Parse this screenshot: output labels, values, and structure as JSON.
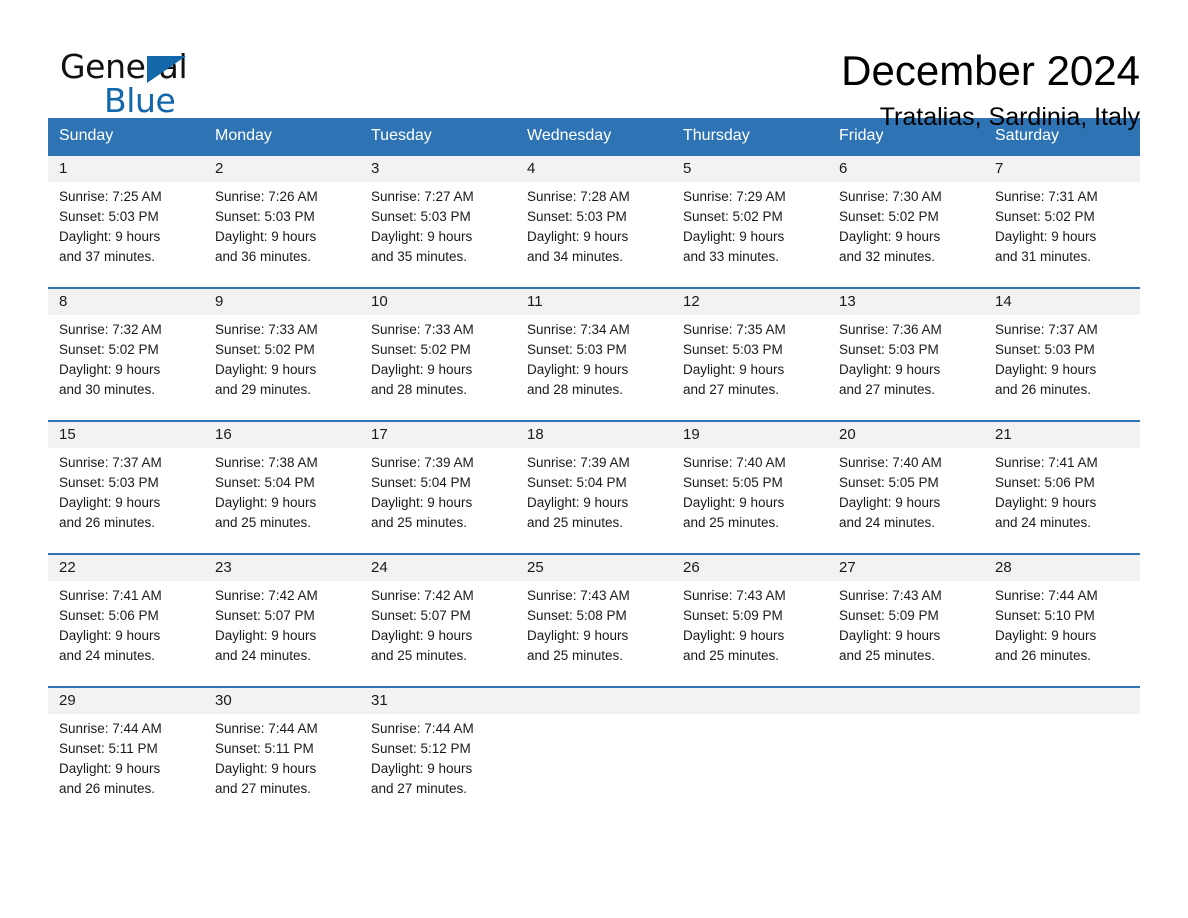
{
  "brand": {
    "name_dark": "General",
    "name_light": "Blue",
    "triangle_color": "#1368ab"
  },
  "header": {
    "title": "December 2024",
    "subtitle": "Tratalias, Sardinia, Italy"
  },
  "theme": {
    "header_blue": "#2e74b5",
    "daynum_band": "#f2f2f2",
    "text": "#1a1a1a"
  },
  "weekday_headers": [
    "Sunday",
    "Monday",
    "Tuesday",
    "Wednesday",
    "Thursday",
    "Friday",
    "Saturday"
  ],
  "labels": {
    "sunrise_prefix": "Sunrise:",
    "sunset_prefix": "Sunset:",
    "daylight_prefix": "Daylight:"
  },
  "weeks": [
    [
      {
        "day": "1",
        "sunrise": "Sunrise: 7:25 AM",
        "sunset": "Sunset: 5:03 PM",
        "daylight_line1": "Daylight: 9 hours",
        "daylight_line2": "and 37 minutes."
      },
      {
        "day": "2",
        "sunrise": "Sunrise: 7:26 AM",
        "sunset": "Sunset: 5:03 PM",
        "daylight_line1": "Daylight: 9 hours",
        "daylight_line2": "and 36 minutes."
      },
      {
        "day": "3",
        "sunrise": "Sunrise: 7:27 AM",
        "sunset": "Sunset: 5:03 PM",
        "daylight_line1": "Daylight: 9 hours",
        "daylight_line2": "and 35 minutes."
      },
      {
        "day": "4",
        "sunrise": "Sunrise: 7:28 AM",
        "sunset": "Sunset: 5:03 PM",
        "daylight_line1": "Daylight: 9 hours",
        "daylight_line2": "and 34 minutes."
      },
      {
        "day": "5",
        "sunrise": "Sunrise: 7:29 AM",
        "sunset": "Sunset: 5:02 PM",
        "daylight_line1": "Daylight: 9 hours",
        "daylight_line2": "and 33 minutes."
      },
      {
        "day": "6",
        "sunrise": "Sunrise: 7:30 AM",
        "sunset": "Sunset: 5:02 PM",
        "daylight_line1": "Daylight: 9 hours",
        "daylight_line2": "and 32 minutes."
      },
      {
        "day": "7",
        "sunrise": "Sunrise: 7:31 AM",
        "sunset": "Sunset: 5:02 PM",
        "daylight_line1": "Daylight: 9 hours",
        "daylight_line2": "and 31 minutes."
      }
    ],
    [
      {
        "day": "8",
        "sunrise": "Sunrise: 7:32 AM",
        "sunset": "Sunset: 5:02 PM",
        "daylight_line1": "Daylight: 9 hours",
        "daylight_line2": "and 30 minutes."
      },
      {
        "day": "9",
        "sunrise": "Sunrise: 7:33 AM",
        "sunset": "Sunset: 5:02 PM",
        "daylight_line1": "Daylight: 9 hours",
        "daylight_line2": "and 29 minutes."
      },
      {
        "day": "10",
        "sunrise": "Sunrise: 7:33 AM",
        "sunset": "Sunset: 5:02 PM",
        "daylight_line1": "Daylight: 9 hours",
        "daylight_line2": "and 28 minutes."
      },
      {
        "day": "11",
        "sunrise": "Sunrise: 7:34 AM",
        "sunset": "Sunset: 5:03 PM",
        "daylight_line1": "Daylight: 9 hours",
        "daylight_line2": "and 28 minutes."
      },
      {
        "day": "12",
        "sunrise": "Sunrise: 7:35 AM",
        "sunset": "Sunset: 5:03 PM",
        "daylight_line1": "Daylight: 9 hours",
        "daylight_line2": "and 27 minutes."
      },
      {
        "day": "13",
        "sunrise": "Sunrise: 7:36 AM",
        "sunset": "Sunset: 5:03 PM",
        "daylight_line1": "Daylight: 9 hours",
        "daylight_line2": "and 27 minutes."
      },
      {
        "day": "14",
        "sunrise": "Sunrise: 7:37 AM",
        "sunset": "Sunset: 5:03 PM",
        "daylight_line1": "Daylight: 9 hours",
        "daylight_line2": "and 26 minutes."
      }
    ],
    [
      {
        "day": "15",
        "sunrise": "Sunrise: 7:37 AM",
        "sunset": "Sunset: 5:03 PM",
        "daylight_line1": "Daylight: 9 hours",
        "daylight_line2": "and 26 minutes."
      },
      {
        "day": "16",
        "sunrise": "Sunrise: 7:38 AM",
        "sunset": "Sunset: 5:04 PM",
        "daylight_line1": "Daylight: 9 hours",
        "daylight_line2": "and 25 minutes."
      },
      {
        "day": "17",
        "sunrise": "Sunrise: 7:39 AM",
        "sunset": "Sunset: 5:04 PM",
        "daylight_line1": "Daylight: 9 hours",
        "daylight_line2": "and 25 minutes."
      },
      {
        "day": "18",
        "sunrise": "Sunrise: 7:39 AM",
        "sunset": "Sunset: 5:04 PM",
        "daylight_line1": "Daylight: 9 hours",
        "daylight_line2": "and 25 minutes."
      },
      {
        "day": "19",
        "sunrise": "Sunrise: 7:40 AM",
        "sunset": "Sunset: 5:05 PM",
        "daylight_line1": "Daylight: 9 hours",
        "daylight_line2": "and 25 minutes."
      },
      {
        "day": "20",
        "sunrise": "Sunrise: 7:40 AM",
        "sunset": "Sunset: 5:05 PM",
        "daylight_line1": "Daylight: 9 hours",
        "daylight_line2": "and 24 minutes."
      },
      {
        "day": "21",
        "sunrise": "Sunrise: 7:41 AM",
        "sunset": "Sunset: 5:06 PM",
        "daylight_line1": "Daylight: 9 hours",
        "daylight_line2": "and 24 minutes."
      }
    ],
    [
      {
        "day": "22",
        "sunrise": "Sunrise: 7:41 AM",
        "sunset": "Sunset: 5:06 PM",
        "daylight_line1": "Daylight: 9 hours",
        "daylight_line2": "and 24 minutes."
      },
      {
        "day": "23",
        "sunrise": "Sunrise: 7:42 AM",
        "sunset": "Sunset: 5:07 PM",
        "daylight_line1": "Daylight: 9 hours",
        "daylight_line2": "and 24 minutes."
      },
      {
        "day": "24",
        "sunrise": "Sunrise: 7:42 AM",
        "sunset": "Sunset: 5:07 PM",
        "daylight_line1": "Daylight: 9 hours",
        "daylight_line2": "and 25 minutes."
      },
      {
        "day": "25",
        "sunrise": "Sunrise: 7:43 AM",
        "sunset": "Sunset: 5:08 PM",
        "daylight_line1": "Daylight: 9 hours",
        "daylight_line2": "and 25 minutes."
      },
      {
        "day": "26",
        "sunrise": "Sunrise: 7:43 AM",
        "sunset": "Sunset: 5:09 PM",
        "daylight_line1": "Daylight: 9 hours",
        "daylight_line2": "and 25 minutes."
      },
      {
        "day": "27",
        "sunrise": "Sunrise: 7:43 AM",
        "sunset": "Sunset: 5:09 PM",
        "daylight_line1": "Daylight: 9 hours",
        "daylight_line2": "and 25 minutes."
      },
      {
        "day": "28",
        "sunrise": "Sunrise: 7:44 AM",
        "sunset": "Sunset: 5:10 PM",
        "daylight_line1": "Daylight: 9 hours",
        "daylight_line2": "and 26 minutes."
      }
    ],
    [
      {
        "day": "29",
        "sunrise": "Sunrise: 7:44 AM",
        "sunset": "Sunset: 5:11 PM",
        "daylight_line1": "Daylight: 9 hours",
        "daylight_line2": "and 26 minutes."
      },
      {
        "day": "30",
        "sunrise": "Sunrise: 7:44 AM",
        "sunset": "Sunset: 5:11 PM",
        "daylight_line1": "Daylight: 9 hours",
        "daylight_line2": "and 27 minutes."
      },
      {
        "day": "31",
        "sunrise": "Sunrise: 7:44 AM",
        "sunset": "Sunset: 5:12 PM",
        "daylight_line1": "Daylight: 9 hours",
        "daylight_line2": "and 27 minutes."
      },
      {
        "day": "",
        "sunrise": "",
        "sunset": "",
        "daylight_line1": "",
        "daylight_line2": ""
      },
      {
        "day": "",
        "sunrise": "",
        "sunset": "",
        "daylight_line1": "",
        "daylight_line2": ""
      },
      {
        "day": "",
        "sunrise": "",
        "sunset": "",
        "daylight_line1": "",
        "daylight_line2": ""
      },
      {
        "day": "",
        "sunrise": "",
        "sunset": "",
        "daylight_line1": "",
        "daylight_line2": ""
      }
    ]
  ]
}
